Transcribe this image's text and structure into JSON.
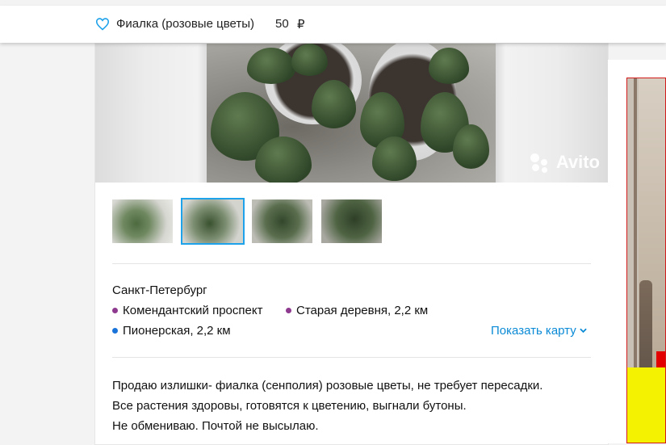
{
  "header": {
    "title": "Фиалка (розовые цветы)",
    "price": "50",
    "currency": "₽",
    "favorite_icon": "heart-outline-icon",
    "accent": "#1ea2ea"
  },
  "gallery": {
    "watermark": "Avito",
    "thumbnails": [
      {
        "label": "photo-1",
        "selected": false
      },
      {
        "label": "photo-2",
        "selected": true
      },
      {
        "label": "photo-3",
        "selected": false
      },
      {
        "label": "photo-4",
        "selected": false
      }
    ]
  },
  "location": {
    "city": "Санкт-Петербург",
    "address": "Комендантский проспект",
    "stations": [
      {
        "name": "Старая деревня, 2,2 км",
        "color": "#8e3a8e"
      },
      {
        "name": "Пионерская, 2,2 км",
        "color": "#1a73d9"
      }
    ],
    "address_dot_color": "#8e3a8e",
    "show_map": "Показать карту"
  },
  "description": {
    "lines": [
      "Продаю излишки- фиалка (сенполия) розовые цветы, не требует пересадки.",
      "Все растения здоровы, готовятся к цветению, выгнали бутоны.",
      "Не обмениваю. Почтой не высылаю."
    ]
  }
}
